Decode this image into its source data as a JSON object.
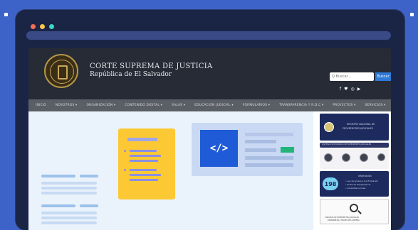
{
  "browser": {
    "dot_colors": [
      "#f36f56",
      "#f9c74f",
      "#3bd6c6"
    ]
  },
  "site": {
    "title": "CORTE SUPREMA DE JUSTICIA",
    "subtitle": "República de El Salvador",
    "search_placeholder": "Q Buscar...",
    "search_button": "Buscar",
    "socials": [
      "f",
      "♥",
      "◎",
      "▶"
    ]
  },
  "nav": {
    "items": [
      "INICIO",
      "NOSOTROS ▾",
      "ORGANIZACIÓN ▾",
      "CONTENIDO DIGITAL ▾",
      "SALAS ▾",
      "EDUCACIÓN JUDICIAL ▾",
      "FORMULARIOS ▾",
      "TRANSPARENCIA Y R.D.C ▾",
      "PROYECTOS ▾",
      "SERVICIOS ▾"
    ]
  },
  "hero": {
    "code_symbol": "</>"
  },
  "sidebar": {
    "banner1_line1": "REGISTRO NACIONAL DE",
    "banner1_line2": "PROVEEDORES JUDICIALES",
    "bar_text": "SISTEMA ELECTRÓNICO DE EXPEDIENTES JUDICIALES",
    "badge_number": "198",
    "info_title": "Información",
    "info_line1": "• Ley de Acceso a la Información",
    "info_line2": "• Portal de Transparencia",
    "info_line3": "• Consultas en línea",
    "consult_line1": "CONSULTA DE EXPEDIENTES JUDICIALES",
    "consult_line2": "DISPONIBLES A TRAVÉS DEL SISTEMA"
  }
}
